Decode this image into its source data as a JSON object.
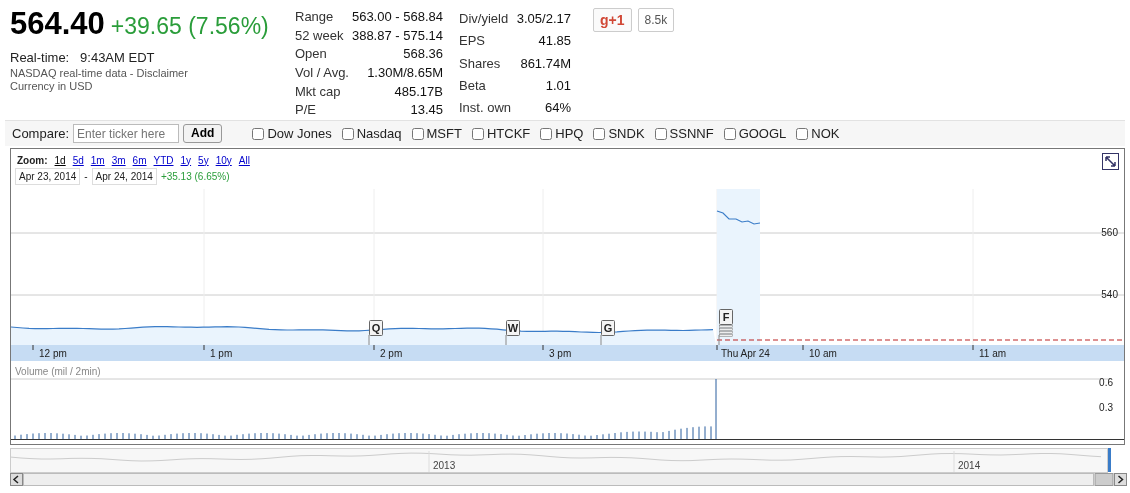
{
  "quote": {
    "price": "564.40",
    "change": "+39.65 (7.56%)",
    "realtime_label": "Real-time:",
    "realtime_value": "9:43AM EDT",
    "source": "NASDAQ real-time data - ",
    "disclaimer": "Disclaimer",
    "currency": "Currency in USD"
  },
  "stats_left": [
    {
      "label": "Range",
      "value": "563.00 - 568.84"
    },
    {
      "label": "52 week",
      "value": "388.87 - 575.14"
    },
    {
      "label": "Open",
      "value": "568.36"
    },
    {
      "label": "Vol / Avg.",
      "value": "1.30M/8.65M"
    },
    {
      "label": "Mkt cap",
      "value": "485.17B"
    },
    {
      "label": "P/E",
      "value": "13.45"
    }
  ],
  "stats_right": [
    {
      "label": "Div/yield",
      "value": "3.05/2.17"
    },
    {
      "label": "EPS",
      "value": "41.85"
    },
    {
      "label": "Shares",
      "value": "861.74M"
    },
    {
      "label": "Beta",
      "value": "1.01"
    },
    {
      "label": "Inst. own",
      "value": "64%"
    }
  ],
  "social": {
    "button": "g+1",
    "count": "8.5k"
  },
  "compare": {
    "label": "Compare:",
    "placeholder": "Enter ticker here",
    "button": "Add",
    "tickers": [
      {
        "label": "Dow Jones",
        "checked": false
      },
      {
        "label": "Nasdaq",
        "checked": false
      },
      {
        "label": "MSFT",
        "checked": false
      },
      {
        "label": "HTCKF",
        "checked": false
      },
      {
        "label": "HPQ",
        "checked": false
      },
      {
        "label": "SNDK",
        "checked": false
      },
      {
        "label": "SSNNF",
        "checked": false
      },
      {
        "label": "GOOGL",
        "checked": false
      },
      {
        "label": "NOK",
        "checked": false
      }
    ]
  },
  "chart": {
    "zoom_label": "Zoom:",
    "ranges": [
      {
        "label": "1d",
        "selected": true
      },
      {
        "label": "5d",
        "selected": false
      },
      {
        "label": "1m",
        "selected": false
      },
      {
        "label": "3m",
        "selected": false
      },
      {
        "label": "6m",
        "selected": false
      },
      {
        "label": "YTD",
        "selected": false
      },
      {
        "label": "1y",
        "selected": false
      },
      {
        "label": "5y",
        "selected": false
      },
      {
        "label": "10y",
        "selected": false
      },
      {
        "label": "All",
        "selected": false
      }
    ],
    "date_from": "Apr 23, 2014",
    "separator": "-",
    "date_to": "Apr 24, 2014",
    "range_change": "+35.13 (6.65%)",
    "y_labels": [
      "560",
      "540"
    ],
    "x_labels": [
      "12 pm",
      "1 pm",
      "2 pm",
      "3 pm",
      "Thu Apr 24",
      "10 am",
      "11 am"
    ],
    "events": [
      "Q",
      "W",
      "G",
      "F"
    ],
    "volume_title": "Volume (mil / 2min)",
    "volume_labels": [
      "0.6",
      "0.3"
    ],
    "navigator_labels": [
      "2013",
      "2014"
    ]
  }
}
